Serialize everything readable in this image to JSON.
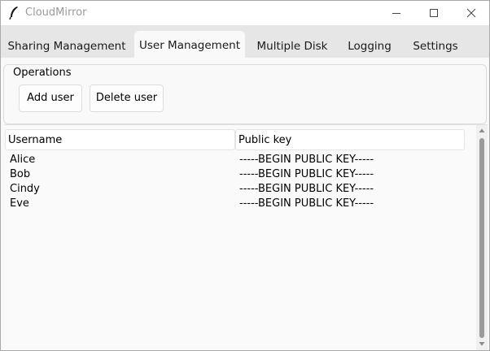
{
  "window": {
    "title": "CloudMirror"
  },
  "tabs": [
    {
      "label": "Sharing Management",
      "active": false
    },
    {
      "label": "User Management",
      "active": true
    },
    {
      "label": "Multiple Disk",
      "active": false
    },
    {
      "label": "Logging",
      "active": false
    },
    {
      "label": "Settings",
      "active": false
    }
  ],
  "operations": {
    "label": "Operations",
    "add_user": "Add user",
    "delete_user": "Delete user"
  },
  "table": {
    "columns": [
      "Username",
      "Public key"
    ],
    "rows": [
      {
        "username": "Alice",
        "public_key": "-----BEGIN PUBLIC KEY-----"
      },
      {
        "username": "Bob",
        "public_key": "-----BEGIN PUBLIC KEY-----"
      },
      {
        "username": "Cindy",
        "public_key": "-----BEGIN PUBLIC KEY-----"
      },
      {
        "username": "Eve",
        "public_key": "-----BEGIN PUBLIC KEY-----"
      }
    ]
  },
  "icons": {
    "app": "feather-icon",
    "minimize": "minimize-icon",
    "maximize": "maximize-icon",
    "close": "close-icon"
  }
}
